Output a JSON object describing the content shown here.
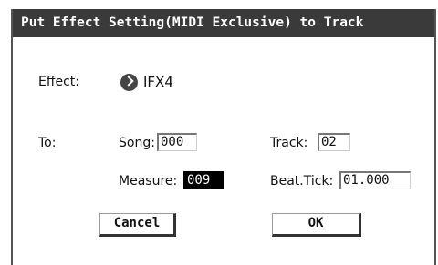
{
  "dialog": {
    "title": "Put Effect Setting(MIDI Exclusive) to Track"
  },
  "effect": {
    "label": "Effect:",
    "icon": "arrow-right-icon",
    "value": "IFX4"
  },
  "destination": {
    "label": "To:",
    "song": {
      "label": "Song:",
      "value": "000"
    },
    "track": {
      "label": "Track:",
      "value": "02"
    },
    "measure": {
      "label": "Measure:",
      "value": "009"
    },
    "beat_tick": {
      "label": "Beat.Tick:",
      "value": "01.000"
    }
  },
  "buttons": {
    "cancel": "Cancel",
    "ok": "OK"
  }
}
